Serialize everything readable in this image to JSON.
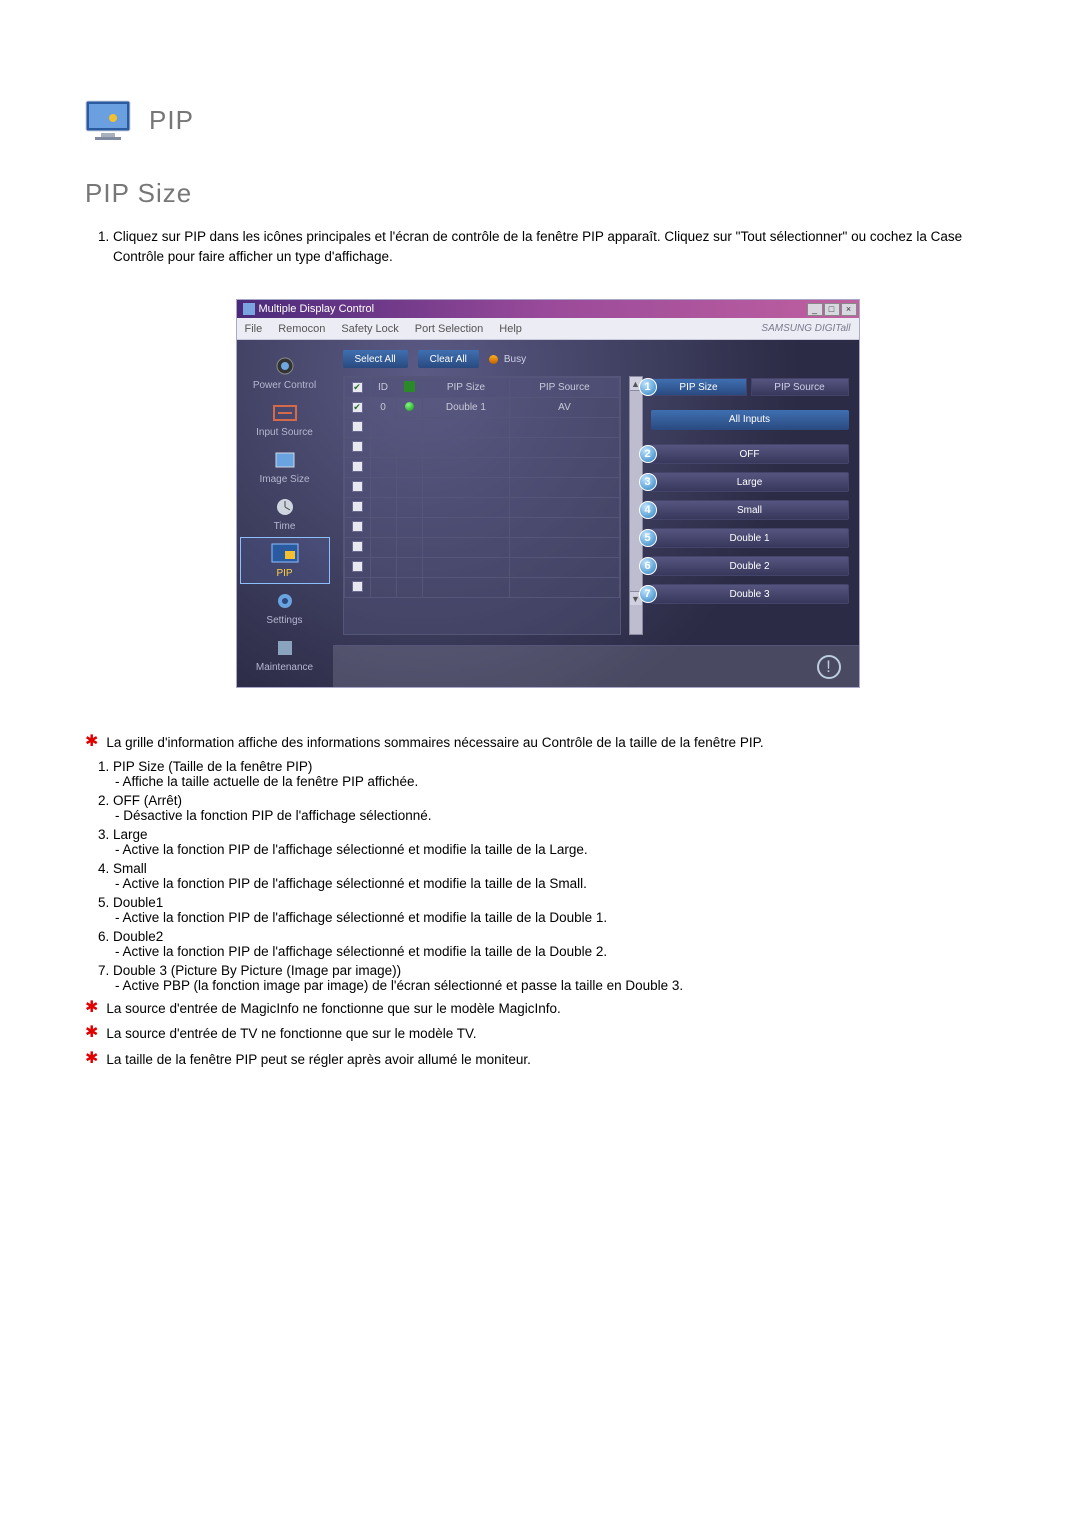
{
  "heading": {
    "main": "PIP",
    "sub": "PIP Size"
  },
  "intro": {
    "items": [
      "Cliquez sur PIP dans les icônes principales et l'écran de contrôle de la fenêtre PIP apparaît. Cliquez sur \"Tout sélectionner\" ou cochez la Case Contrôle pour faire afficher un type d'affichage."
    ]
  },
  "app": {
    "title": "Multiple Display Control",
    "brand": "SAMSUNG DIGITall",
    "menus": [
      "File",
      "Remocon",
      "Safety Lock",
      "Port Selection",
      "Help"
    ],
    "sidebar": [
      {
        "label": "Power Control"
      },
      {
        "label": "Input Source"
      },
      {
        "label": "Image Size"
      },
      {
        "label": "Time"
      },
      {
        "label": "PIP"
      },
      {
        "label": "Settings"
      },
      {
        "label": "Maintenance"
      }
    ],
    "toolbar": {
      "select_all": "Select All",
      "clear_all": "Clear All",
      "busy": "Busy"
    },
    "grid": {
      "headers": {
        "col_id": "ID",
        "col_pip_size": "PIP Size",
        "col_pip_source": "PIP Source"
      },
      "rows": [
        {
          "checked": true,
          "id": "0",
          "status": "on",
          "pip_size": "Double 1",
          "pip_source": "AV"
        },
        {
          "checked": false
        },
        {
          "checked": false
        },
        {
          "checked": false
        },
        {
          "checked": false
        },
        {
          "checked": false
        },
        {
          "checked": false
        },
        {
          "checked": false
        },
        {
          "checked": false
        },
        {
          "checked": false
        }
      ]
    },
    "panel": {
      "tabs": {
        "pip_size": "PIP Size",
        "pip_source": "PIP Source"
      },
      "all_inputs": "All Inputs",
      "buttons": [
        {
          "n": "2",
          "label": "OFF"
        },
        {
          "n": "3",
          "label": "Large"
        },
        {
          "n": "4",
          "label": "Small"
        },
        {
          "n": "5",
          "label": "Double 1"
        },
        {
          "n": "6",
          "label": "Double 2"
        },
        {
          "n": "7",
          "label": "Double 3"
        }
      ],
      "callout1": "1"
    }
  },
  "star1": "La grille d'information affiche des informations sommaires nécessaire au Contrôle de la taille de la fenêtre PIP.",
  "list": [
    {
      "term": "PIP Size (Taille de la fenêtre PIP)",
      "sub": "Affiche la taille actuelle de la fenêtre PIP affichée."
    },
    {
      "term": "OFF (Arrêt)",
      "sub": "Désactive la fonction PIP de l'affichage sélectionné."
    },
    {
      "term": "Large",
      "sub": "Active la fonction PIP de l'affichage sélectionné et modifie la taille de la Large."
    },
    {
      "term": "Small",
      "sub": "Active la fonction PIP de l'affichage sélectionné et modifie la taille de la Small."
    },
    {
      "term": "Double1",
      "sub": "Active la fonction PIP de l'affichage sélectionné et modifie la taille de la Double 1."
    },
    {
      "term": "Double2",
      "sub": "Active la fonction PIP de l'affichage sélectionné et modifie la taille de la Double 2."
    },
    {
      "term": "Double 3 (Picture By Picture (Image par image))",
      "sub": "Active PBP (la fonction image par image) de l'écran sélectionné et passe la taille en Double 3."
    }
  ],
  "star2": "La source d'entrée de MagicInfo ne fonctionne que sur le modèle MagicInfo.",
  "star3": "La source d'entrée de TV ne fonctionne que sur le modèle TV.",
  "star4": "La taille de la fenêtre PIP peut se régler après avoir allumé le moniteur."
}
